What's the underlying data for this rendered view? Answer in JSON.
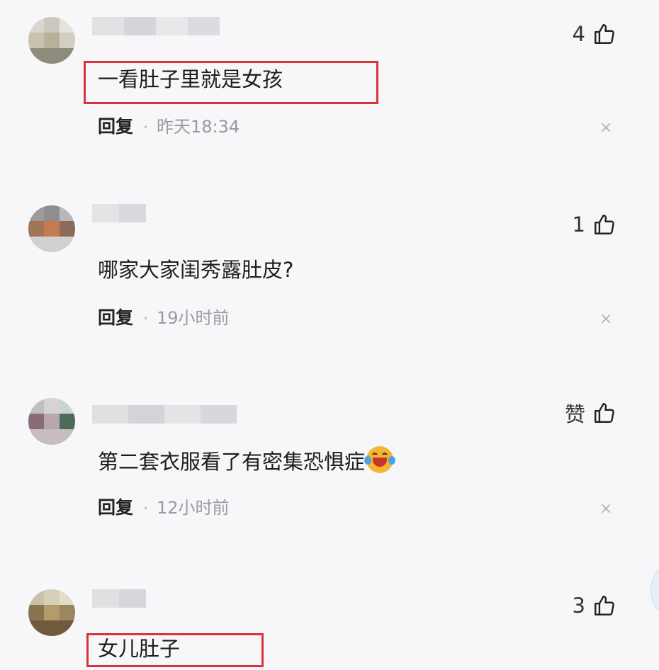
{
  "comments": [
    {
      "text": "一看肚子里就是女孩",
      "reply_label": "回复",
      "separator": "·",
      "time": "昨天18:34",
      "likes": "4",
      "close": "×",
      "highlighted": true
    },
    {
      "text": "哪家大家闺秀露肚皮?",
      "reply_label": "回复",
      "separator": "·",
      "time": "19小时前",
      "likes": "1",
      "close": "×",
      "highlighted": false
    },
    {
      "text": "第二套衣服看了有密集恐惧症",
      "emoji": "laughing-crying-emoji",
      "reply_label": "回复",
      "separator": "·",
      "time": "12小时前",
      "likes": "赞",
      "close": "×",
      "highlighted": false
    },
    {
      "text": "女儿肚子",
      "likes": "3",
      "highlighted": true
    }
  ],
  "icons": {
    "like": "thumbs-up-icon",
    "close": "close-icon"
  },
  "colors": {
    "background": "#f7f7f9",
    "highlight_border": "#d6343a",
    "secondary_text": "#9a9aa0"
  }
}
